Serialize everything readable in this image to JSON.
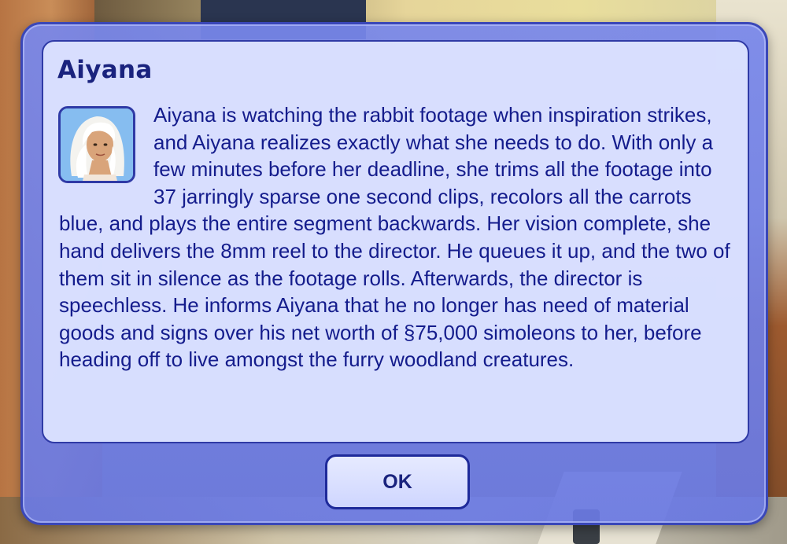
{
  "dialog": {
    "title": "Aiyana",
    "portrait_icon": "sim-portrait-icon",
    "message": "Aiyana is watching the rabbit footage when inspiration strikes, and Aiyana realizes exactly what she needs to do. With only a few minutes before her deadline, she trims all the footage into 37 jarringly sparse one second clips, recolors all the carrots blue, and plays the entire segment backwards. Her vision complete, she hand delivers the 8mm reel to the director. He queues it up, and the two of them sit in silence as the footage rolls. Afterwards, the director is speechless. He informs Aiyana that he no longer has need of material goods and signs over his net worth of §75,000 simoleons to her, before heading off to live amongst the furry woodland creatures.",
    "ok_label": "OK"
  },
  "colors": {
    "dialog_frame": "#6f7ee6",
    "panel": "#dce2ff",
    "text": "#141c8c",
    "border": "#2f3aa6"
  }
}
